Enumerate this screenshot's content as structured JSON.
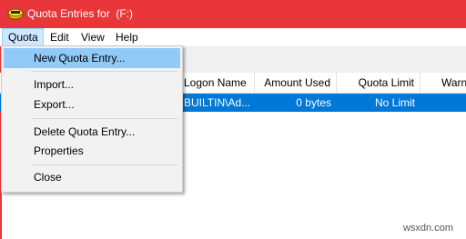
{
  "window": {
    "title": "Quota Entries for  (F:)"
  },
  "menubar": {
    "items": [
      "Quota",
      "Edit",
      "View",
      "Help"
    ]
  },
  "dropdown": {
    "items": [
      "New Quota Entry...",
      "Import...",
      "Export...",
      "Delete Quota Entry...",
      "Properties",
      "Close"
    ]
  },
  "table": {
    "headers": [
      "Logon Name",
      "Amount Used",
      "Quota Limit",
      "Warn"
    ],
    "row": {
      "logon": "BUILTIN\\Ad...",
      "amount": "0 bytes",
      "limit": "No Limit"
    }
  },
  "colors": {
    "titlebar": "#e8363a",
    "selection": "#0078d7",
    "menu_highlight": "#91c9f7"
  },
  "watermark": "wsxdn.com"
}
